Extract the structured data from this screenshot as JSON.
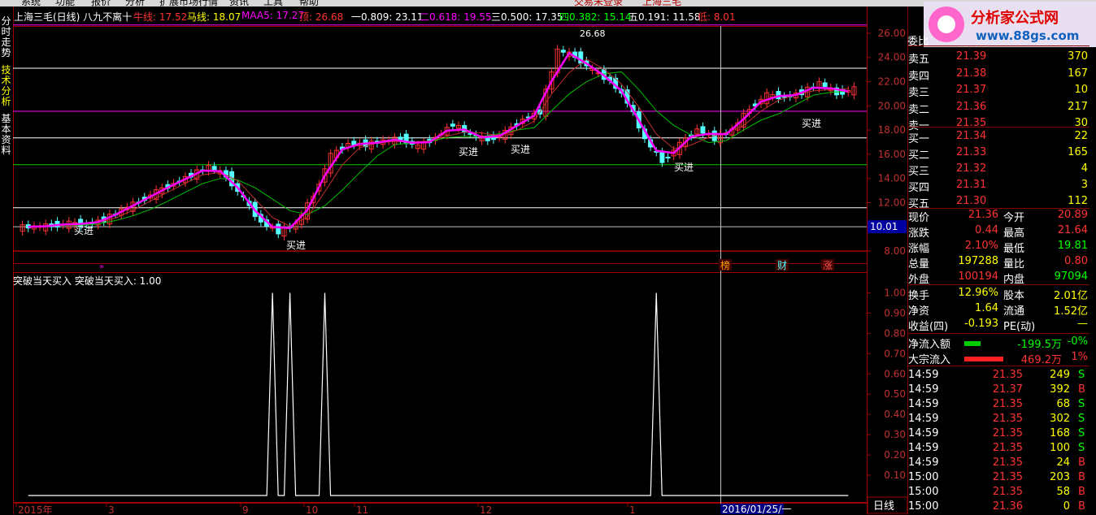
{
  "menu": [
    "系统",
    "功能",
    "报价",
    "分析",
    "扩展市场行情",
    "资讯",
    "工具",
    "帮助"
  ],
  "menu_center": [
    "交易未登录",
    "上海三毛"
  ],
  "tabs": [
    "分时走势",
    "技术分析",
    "基本资料"
  ],
  "header": {
    "stock": "上海三毛(日线) 八九不离十",
    "niu": "牛线: 17.52",
    "ma": "马线: 18.07",
    "maa5": "MAA5: 17.27",
    "top": "顶: 26.68",
    "fib0809": "一0.809: 23.11",
    "fib0618": "二0.618: 19.55",
    "fib0500": "三0.500: 17.35",
    "fib0382": "四0.382: 15.14",
    "fib0191": "五0.191: 11.58",
    "low": "低: 8.01"
  },
  "chart_data": [
    {
      "type": "candlestick",
      "title": "上海三毛(日线)",
      "ylim": [
        7,
        27
      ],
      "yticks": [
        "26.00",
        "24.00",
        "22.00",
        "20.00",
        "18.00",
        "16.00",
        "14.00",
        "12.00",
        "10.00",
        "8.00"
      ],
      "crosshair_value": "10.01",
      "fib_levels": [
        26.68,
        23.11,
        19.55,
        17.35,
        15.14,
        11.58,
        10.01,
        8.01
      ],
      "peak_label": "26.68",
      "buy_label": "买进",
      "markers": [
        "榜",
        "财",
        "涨"
      ],
      "x_ticks": [
        "2015年",
        "3",
        "9",
        "10",
        "11",
        "12",
        "1"
      ],
      "close_approx": [
        10,
        10.1,
        10.3,
        10.2,
        10.6,
        11.4,
        12.1,
        12.9,
        13.6,
        14.3,
        15.0,
        14.2,
        12.3,
        10.4,
        9.6,
        10.2,
        12.6,
        15.9,
        16.9,
        16.8,
        17.1,
        17.3,
        16.6,
        17.4,
        18.5,
        17.6,
        17.2,
        17.8,
        18.9,
        19.5,
        24.6,
        24.1,
        22.9,
        22.1,
        20.4,
        17.2,
        15.4,
        16.8,
        18.1,
        17.3,
        18.0,
        19.8,
        20.9,
        20.7,
        21.1,
        21.9,
        21.0,
        21.4
      ]
    },
    {
      "type": "line",
      "title": "突破当天买入 突破当天买入: 1.00",
      "ylim": [
        0,
        1.05
      ],
      "yticks": [
        "1.00",
        "0.90",
        "0.80",
        "0.70",
        "0.60",
        "0.50",
        "0.40",
        "0.30",
        "0.20",
        "0.10"
      ],
      "spikes_at_bar": [
        14,
        15,
        17,
        36
      ],
      "date_label": "2016/01/25/一",
      "period": "日线"
    }
  ],
  "quote": {
    "weibi": "委比",
    "asks": [
      [
        "卖五",
        "21.39",
        "370"
      ],
      [
        "卖四",
        "21.38",
        "167"
      ],
      [
        "卖三",
        "21.37",
        "10"
      ],
      [
        "卖二",
        "21.36",
        "217"
      ],
      [
        "卖一",
        "21.35",
        "30"
      ]
    ],
    "bids": [
      [
        "买一",
        "21.34",
        "22"
      ],
      [
        "买二",
        "21.33",
        "165"
      ],
      [
        "买三",
        "21.32",
        "4"
      ],
      [
        "买四",
        "21.31",
        "3"
      ],
      [
        "买五",
        "21.30",
        "112"
      ]
    ],
    "stats": [
      [
        "现价",
        "21.36",
        "今开",
        "20.89"
      ],
      [
        "涨跌",
        "0.44",
        "最高",
        "21.64"
      ],
      [
        "涨幅",
        "2.10%",
        "最低",
        "19.81"
      ],
      [
        "总量",
        "197288",
        "量比",
        "0.80"
      ],
      [
        "外盘",
        "100194",
        "内盘",
        "97094"
      ]
    ],
    "stats2": [
      [
        "换手",
        "12.96%",
        "股本",
        "2.01亿"
      ],
      [
        "净资",
        "1.64",
        "流通",
        "1.52亿"
      ],
      [
        "收益(四)",
        "-0.193",
        "PE(动)",
        "—"
      ]
    ],
    "flow": [
      [
        "净流入额",
        "-199.5万",
        "-0%"
      ],
      [
        "大宗流入",
        "469.2万",
        "1%"
      ]
    ],
    "ticks": [
      [
        "14:59",
        "21.35",
        "249",
        "S"
      ],
      [
        "14:59",
        "21.37",
        "392",
        "B"
      ],
      [
        "14:59",
        "21.35",
        "68",
        "S"
      ],
      [
        "14:59",
        "21.35",
        "302",
        "S"
      ],
      [
        "14:59",
        "21.35",
        "168",
        "S"
      ],
      [
        "14:59",
        "21.35",
        "100",
        "S"
      ],
      [
        "14:59",
        "21.35",
        "24",
        "B"
      ],
      [
        "15:00",
        "21.35",
        "203",
        "B"
      ],
      [
        "15:00",
        "21.35",
        "58",
        "B"
      ],
      [
        "15:00",
        "21.36",
        "0",
        "B"
      ]
    ]
  },
  "logo": {
    "title": "分析家公式网",
    "url": "www.88gs.com"
  },
  "colors": {
    "up": "#ff3232",
    "down": "#54ffff",
    "magenta": "#ff00ff",
    "red": "#ff0000",
    "green": "#00cc00",
    "white": "#ffffff",
    "yellow": "#ffff00"
  }
}
